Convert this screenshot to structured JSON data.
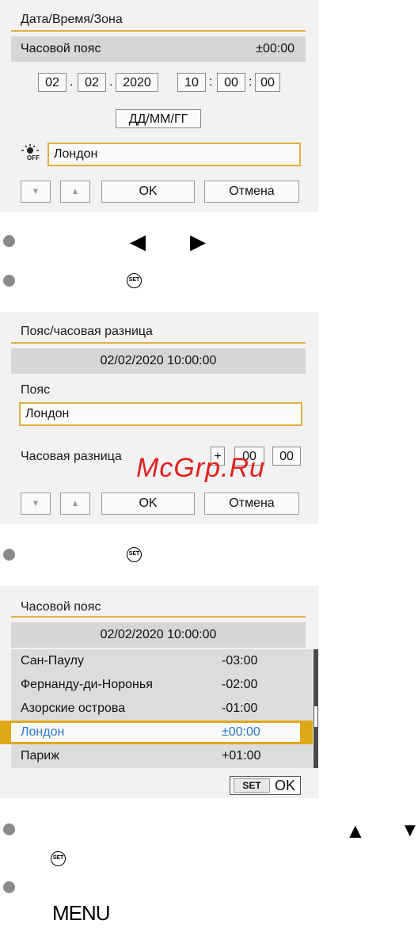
{
  "screen1": {
    "title": "Дата/Время/Зона",
    "zone_label": "Часовой пояс",
    "zone_offset": "±00:00",
    "date_day": "02",
    "date_month": "02",
    "date_year": "2020",
    "date_sep": ".",
    "time_h": "10",
    "time_m": "00",
    "time_s": "00",
    "time_sep": ":",
    "format_btn": "ДД/ММ/ГГ",
    "dst_icon_label": "OFF",
    "zone_value": "Лондон",
    "ok": "OK",
    "cancel": "Отмена"
  },
  "instructions1": {
    "left_arrow": "◀",
    "right_arrow": "▶",
    "set_icon": "SET"
  },
  "screen2": {
    "title": "Пояс/часовая разница",
    "datetime": "02/02/2020 10:00:00",
    "zone_label": "Пояс",
    "zone_value": "Лондон",
    "diff_label": "Часовая разница",
    "diff_sign": "+",
    "diff_h": "00",
    "diff_m": "00",
    "ok": "OK",
    "cancel": "Отмена"
  },
  "screen3": {
    "title": "Часовой пояс",
    "datetime": "02/02/2020 10:00:00",
    "rows": [
      {
        "name": "Сан-Паулу",
        "offset": "-03:00"
      },
      {
        "name": "Фернанду-ди-Норонья",
        "offset": "-02:00"
      },
      {
        "name": "Азорские острова",
        "offset": "-01:00"
      },
      {
        "name": "Лондон",
        "offset": "±00:00"
      },
      {
        "name": "Париж",
        "offset": "+01:00"
      }
    ],
    "set_label": "SET",
    "ok_label": "OK"
  },
  "instructions3": {
    "up_arrow": "▲",
    "down_arrow": "▼",
    "set_icon": "SET",
    "menu": "MENU"
  },
  "watermark": "McGrp.Ru",
  "colors": {
    "accent": "#e0b040",
    "selected_text": "#2a78c8",
    "watermark": "#e02020"
  }
}
